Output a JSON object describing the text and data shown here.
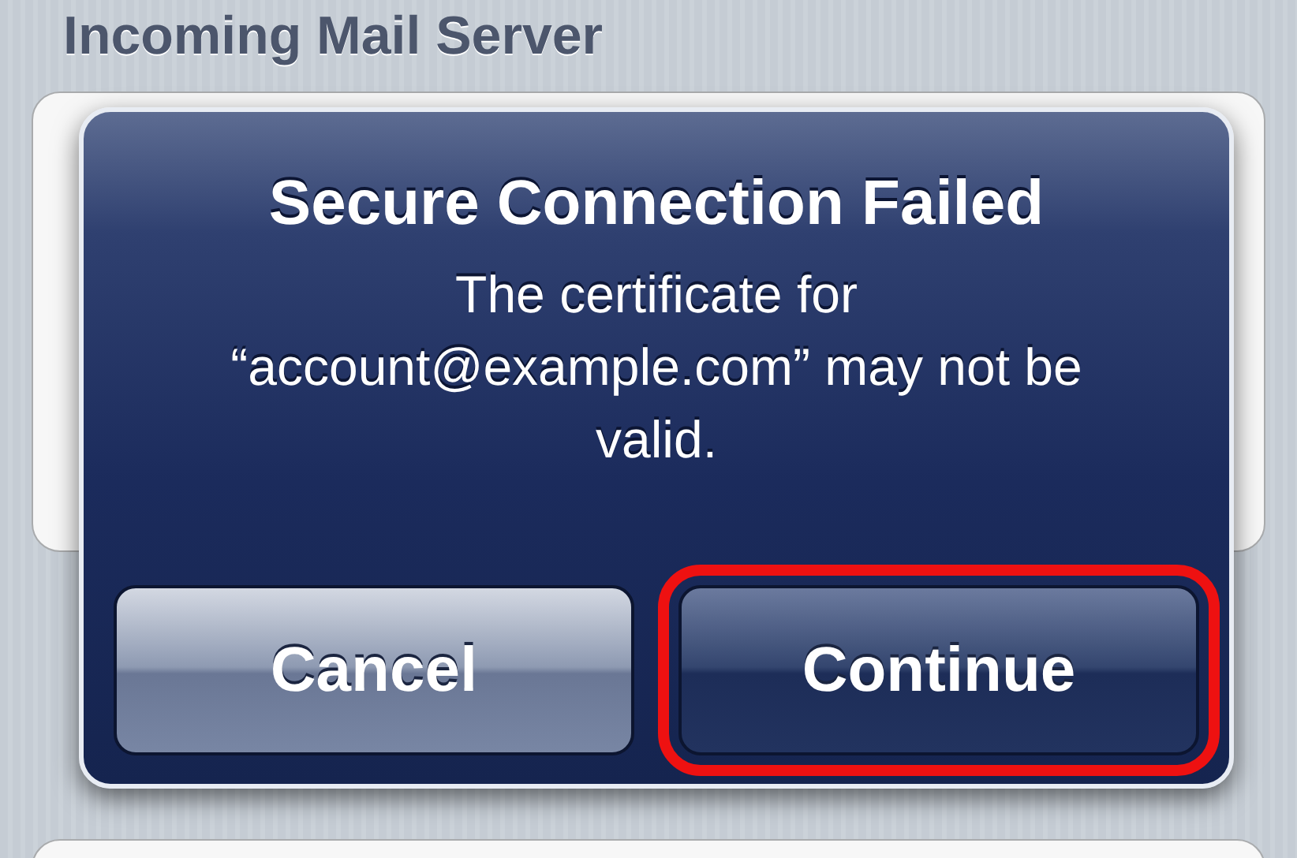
{
  "background": {
    "section_heading": "Incoming Mail Server"
  },
  "alert": {
    "title": "Secure Connection Failed",
    "message": "The certificate for “account@example.com” may not be valid."
  },
  "buttons": [
    {
      "label": "Cancel",
      "kind": "normal",
      "highlighted": false
    },
    {
      "label": "Continue",
      "kind": "default",
      "highlighted": true
    }
  ]
}
